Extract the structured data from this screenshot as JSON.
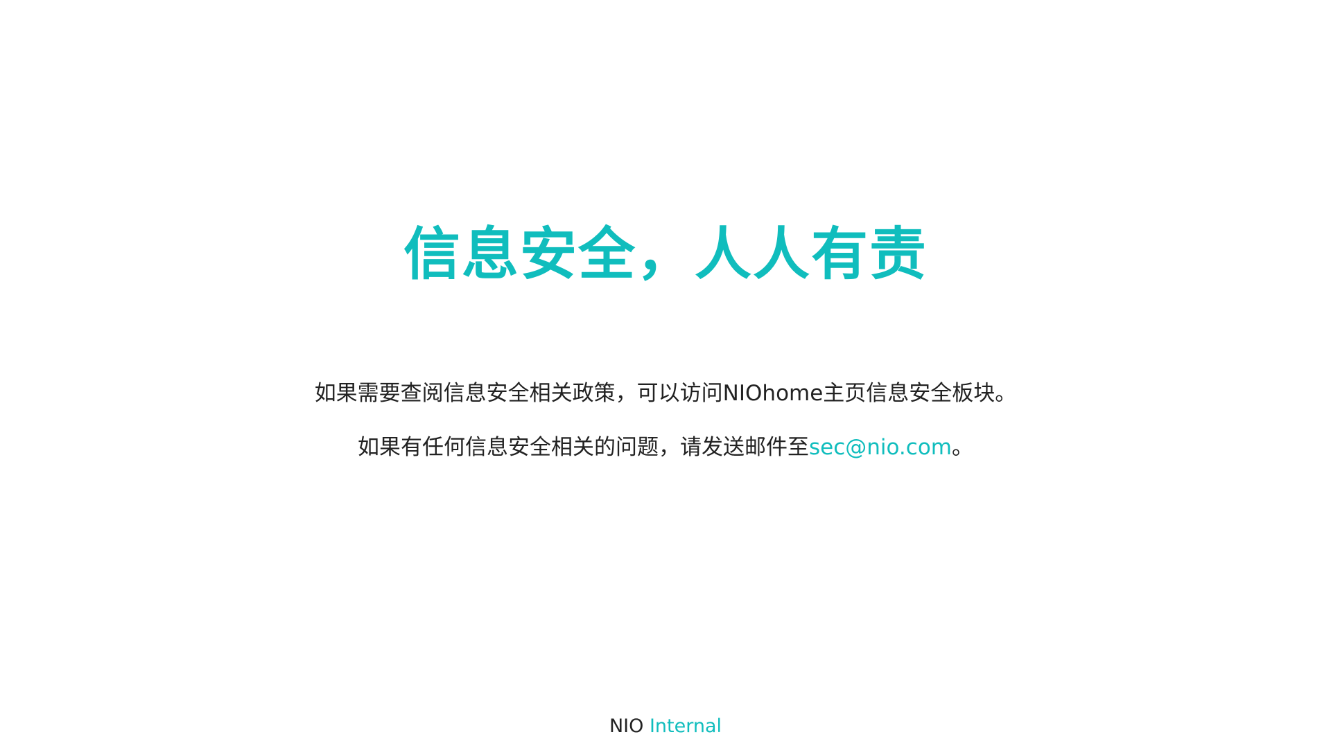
{
  "colors": {
    "accent": "#10bdbd",
    "text": "#222222",
    "background": "#ffffff"
  },
  "slide": {
    "title": "信息安全，人人有责",
    "line1": "如果需要查阅信息安全相关政策，可以访问NIOhome主页信息安全板块。",
    "line2_prefix": "如果有任何信息安全相关的问题，请发送邮件至",
    "email": "sec@nio.com",
    "line2_suffix": "。"
  },
  "footer": {
    "brand": "NIO",
    "classification": "Internal"
  }
}
